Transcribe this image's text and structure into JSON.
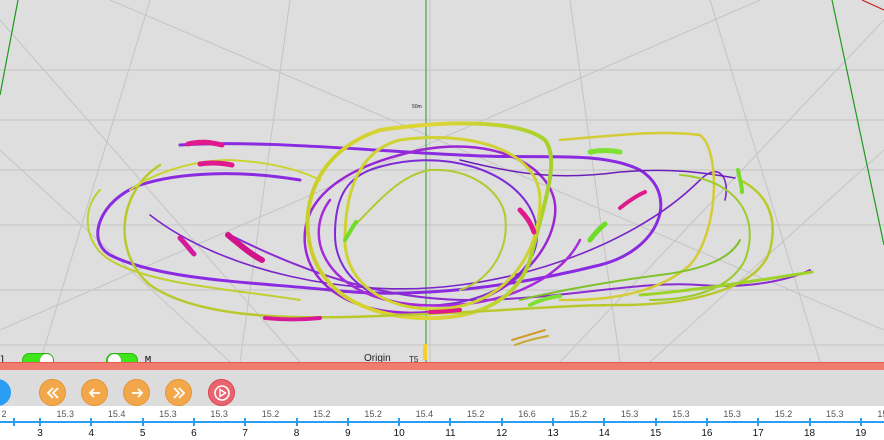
{
  "viewport": {
    "origin_label": "Origin",
    "small_marker_label": "T5",
    "scale_label": "50m"
  },
  "toggles": [
    {
      "name": "left-toggle",
      "label": "l",
      "on": true
    },
    {
      "name": "m-toggle",
      "label": "M",
      "on": true
    }
  ],
  "controls": [
    {
      "name": "rewind-button",
      "icon": "double-left-chevron-icon"
    },
    {
      "name": "step-back-button",
      "icon": "arrow-left-icon"
    },
    {
      "name": "step-forward-button",
      "icon": "arrow-right-icon"
    },
    {
      "name": "fast-forward-button",
      "icon": "double-right-chevron-icon"
    },
    {
      "name": "play-button",
      "icon": "play-circle-icon"
    }
  ],
  "ruler": {
    "values": [
      "2",
      "15.3",
      "15.4",
      "15.3",
      "15.3",
      "15.2",
      "15.2",
      "15.2",
      "15.4",
      "15.2",
      "16.6",
      "15.2",
      "15.3",
      "15.3",
      "15.3",
      "15.2",
      "15.3",
      "15.2"
    ],
    "numbers": [
      "3",
      "4",
      "5",
      "6",
      "7",
      "8",
      "9",
      "10",
      "11",
      "12",
      "13",
      "14",
      "15",
      "16",
      "17",
      "18",
      "19"
    ]
  },
  "colors": {
    "accent_orange": "#f2a84a",
    "timeline_red": "#ef7c6e",
    "toggle_green": "#3ee61a",
    "ruler_blue": "#2a9df4",
    "play_red": "#e8656f"
  }
}
